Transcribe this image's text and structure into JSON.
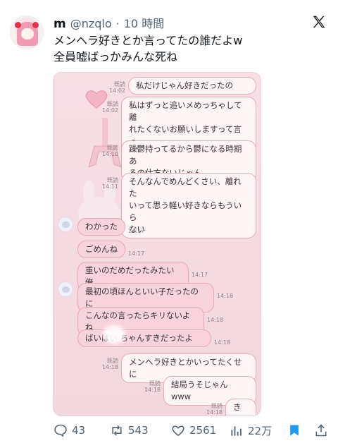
{
  "post": {
    "display_name": "m",
    "handle": "@nzqlo",
    "separator": "·",
    "time": "10 時間",
    "text": "メンヘラ好きとか言ってたの誰だよw\n全員嘘ばっかみんな死ね"
  },
  "chat": {
    "messages": [
      {
        "side": "right",
        "text": "私だけじゃん好きだったの",
        "read": "既読",
        "time": "14:02"
      },
      {
        "side": "right",
        "text": "私はずっと追いメめっちゃして離\nれたくないお願いしますって言っ\nたのに",
        "read": "既読",
        "time": "14:02"
      },
      {
        "side": "right",
        "text": "躁鬱持ってるから鬱になる時期あ\nるの仕方ないじゃん",
        "read": "既読",
        "time": "14:10"
      },
      {
        "side": "right",
        "text": "そんなんでめんどくさい、離れた\nいって思う軽い好きならもういら\nない",
        "read": "既読",
        "time": "14:11"
      },
      {
        "side": "left",
        "text": "わかった",
        "time": "14:17"
      },
      {
        "side": "left",
        "text": "ごめんね",
        "time": "14:17"
      },
      {
        "side": "left",
        "text": "重いのだめだったみたい俺",
        "time": "14:17"
      },
      {
        "side": "left",
        "text": "最初の頃ほんといい子だったのに",
        "time": "14:18"
      },
      {
        "side": "left",
        "text": "こんなの言ったらキリないよね",
        "time": "14:18"
      },
      {
        "side": "left",
        "text": "ばいばい    ちゃんすきだったよ",
        "time": "14:18"
      },
      {
        "side": "right",
        "text": "メンヘラ好きとかいってたくせに",
        "read": "既読",
        "time": "14:18"
      },
      {
        "side": "right",
        "text": "結局うそじゃん www",
        "read": "既読",
        "time": "14:18"
      },
      {
        "side": "right",
        "text": "きも",
        "read": "既読",
        "time": "14:18"
      }
    ]
  },
  "actions": {
    "replies": "43",
    "reposts": "543",
    "likes": "2561",
    "views": "22万"
  },
  "icons": {
    "x_logo": "x-logo-icon",
    "reply": "reply-icon",
    "repost": "repost-icon",
    "like": "heart-icon",
    "views": "views-icon",
    "bookmark": "bookmark-icon",
    "share": "share-icon"
  },
  "colors": {
    "accent": "#1d9bf0",
    "muted": "#536471",
    "chat_bg": "#f8dfe6",
    "bubble_border": "#e9a9b7"
  }
}
